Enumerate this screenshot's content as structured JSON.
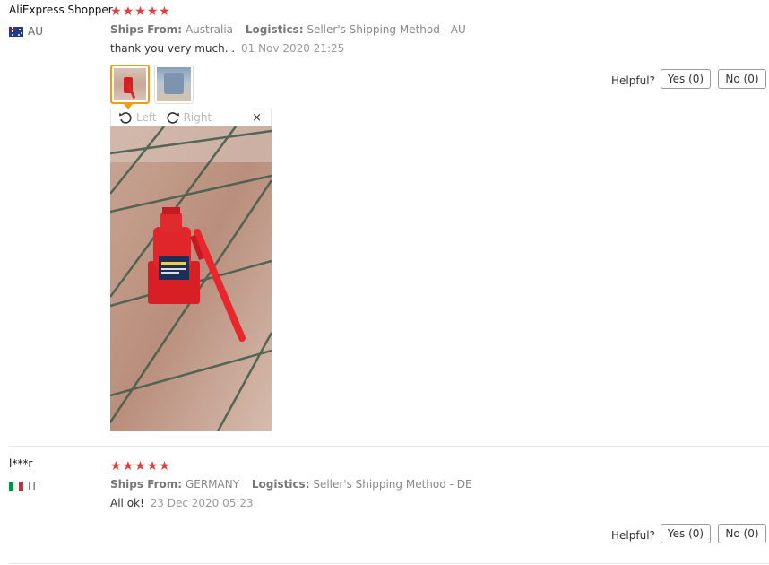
{
  "reviews": [
    {
      "user": "AliExpress Shopper",
      "country_code": "AU",
      "rating": 5,
      "ships_from_label": "Ships From:",
      "ships_from": "Australia",
      "logistics_label": "Logistics:",
      "logistics": "Seller's Shipping Method - AU",
      "text": "thank you very much. .",
      "date": "01 Nov 2020 21:25",
      "helpful_label": "Helpful?",
      "yes_label": "Yes (0)",
      "no_label": "No (0)"
    },
    {
      "user": "l***r",
      "country_code": "IT",
      "rating": 5,
      "ships_from_label": "Ships From:",
      "ships_from": "GERMANY",
      "logistics_label": "Logistics:",
      "logistics": "Seller's Shipping Method - DE",
      "text": "All ok!",
      "date": "23 Dec 2020 05:23",
      "helpful_label": "Helpful?",
      "yes_label": "Yes (0)",
      "no_label": "No (0)"
    }
  ],
  "viewer": {
    "rotate_left_label": "Left",
    "rotate_right_label": "Right",
    "close_label": "×"
  },
  "icons": {
    "star": "star-icon",
    "rotate_left": "rotate-left-icon",
    "rotate_right": "rotate-right-icon",
    "close": "close-icon"
  },
  "colors": {
    "star": "#e43b3b",
    "thumb_active_border": "#f39c12"
  }
}
